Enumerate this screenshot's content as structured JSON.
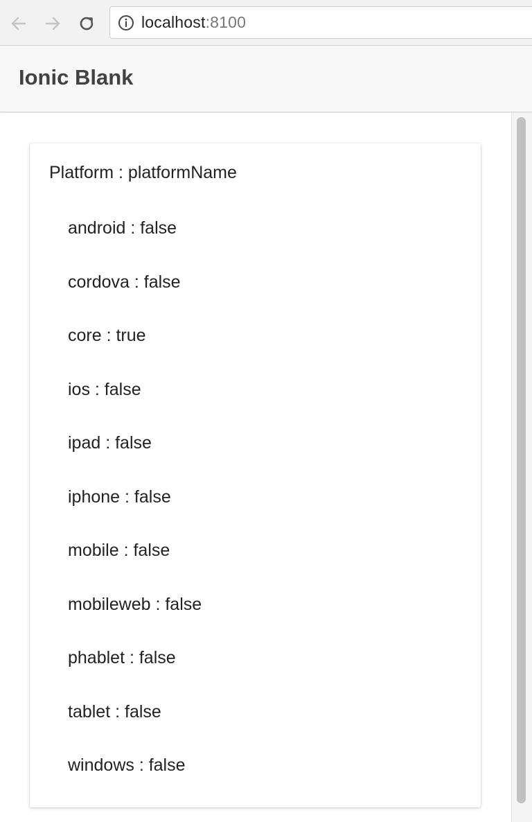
{
  "browser": {
    "url_host": "localhost",
    "url_port": ":8100"
  },
  "header": {
    "title": "Ionic Blank"
  },
  "card": {
    "heading": "Platform : platformName",
    "platforms": [
      "android : false",
      "cordova : false",
      "core : true",
      "ios : false",
      "ipad : false",
      "iphone : false",
      "mobile : false",
      "mobileweb : false",
      "phablet : false",
      "tablet : false",
      "windows : false"
    ]
  },
  "icons": {
    "back": "arrow-left-icon",
    "forward": "arrow-right-icon",
    "reload": "reload-icon",
    "info": "info-icon"
  }
}
